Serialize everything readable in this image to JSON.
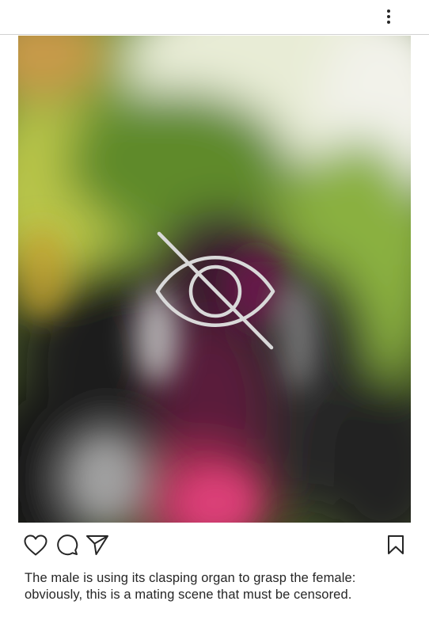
{
  "header": {
    "more_icon": "more-vertical-icon"
  },
  "post": {
    "image_state": "censored-blurred",
    "censor_icon": "eye-slash-icon",
    "actions": {
      "like_icon": "heart-icon",
      "comment_icon": "comment-icon",
      "share_icon": "send-icon",
      "save_icon": "bookmark-icon"
    },
    "caption_line1": "The male is using its clasping organ to grasp the female:",
    "caption_line2": "obviously, this is a mating scene that must be censored."
  },
  "colors": {
    "icon_stroke": "#262626",
    "censor_icon_stroke": "#d9d9d9",
    "divider": "#d2d2d2",
    "text": "#262626"
  }
}
